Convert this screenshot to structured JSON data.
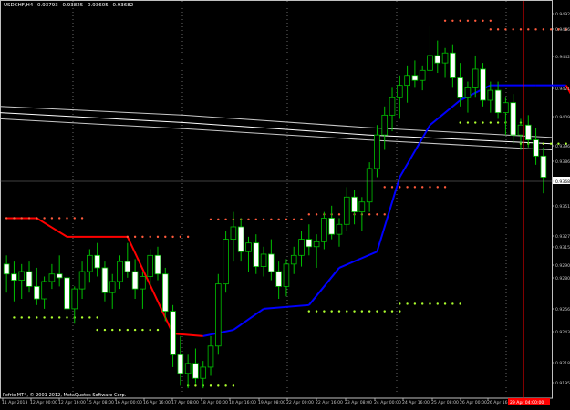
{
  "header": {
    "symbol_timeframe": "USDCHF,H4",
    "ohlc": [
      "0.93793",
      "0.93825",
      "0.93605",
      "0.93682"
    ]
  },
  "footer": {
    "copyright": "Pefrio MT4, © 2001-2012, MetaQuotes Software Corp."
  },
  "colors": {
    "background": "#000000",
    "axis": "#c0c0c0",
    "grid": "#808080",
    "bull": "#00c000",
    "bear_body": "#ffffff",
    "trend_up": "#0000ff",
    "trend_down": "#ff0000",
    "dot_upper": "#ff5a3c",
    "dot_lower": "#adff2f",
    "ma": "#c8c8c8",
    "current_price_box": "#ffffff",
    "vline": "#ff0000"
  },
  "price_axis": {
    "labels": [
      "0.94920",
      "0.94665",
      "0.94420",
      "0.94210",
      "0.94095",
      "0.93960",
      "0.93865",
      "0.93682",
      "0.93510",
      "0.93270",
      "0.93150",
      "0.92905",
      "0.92800",
      "0.92565",
      "0.92435",
      "0.92185",
      "0.91950"
    ],
    "current_price": "0.93682"
  },
  "time_axis": {
    "labels": [
      "11 Apr 2013",
      "12 Apr 00:00",
      "12 Apr 16:00",
      "15 Apr 08:00",
      "16 Apr 00:00",
      "16 Apr 16:00",
      "17 Apr 08:00",
      "18 Apr 00:00",
      "18 Apr 16:00",
      "19 Apr 08:00",
      "22 Apr 00:00",
      "22 Apr 16:00",
      "23 Apr 08:00",
      "24 Apr 00:00",
      "24 Apr 16:00",
      "25 Apr 08:00",
      "26 Apr 00:00",
      "26 Apr 16:00"
    ],
    "highlight_label": "29 Apr 04:00:00"
  },
  "chart_data": {
    "type": "candlestick",
    "price_range": [
      0.919,
      0.951
    ],
    "candles": [
      [
        0.9298,
        0.9305,
        0.9275,
        0.929
      ],
      [
        0.929,
        0.93,
        0.9268,
        0.9285
      ],
      [
        0.9285,
        0.9298,
        0.927,
        0.9292
      ],
      [
        0.9292,
        0.93,
        0.9275,
        0.928
      ],
      [
        0.928,
        0.9295,
        0.9265,
        0.927
      ],
      [
        0.927,
        0.9288,
        0.9262,
        0.9284
      ],
      [
        0.9284,
        0.9298,
        0.9278,
        0.929
      ],
      [
        0.929,
        0.9305,
        0.928,
        0.9287
      ],
      [
        0.9287,
        0.9292,
        0.9255,
        0.9262
      ],
      [
        0.9262,
        0.928,
        0.925,
        0.9278
      ],
      [
        0.9278,
        0.93,
        0.927,
        0.9292
      ],
      [
        0.9292,
        0.931,
        0.9283,
        0.9305
      ],
      [
        0.9305,
        0.9315,
        0.9288,
        0.9295
      ],
      [
        0.9295,
        0.93,
        0.9268,
        0.9275
      ],
      [
        0.9275,
        0.929,
        0.9262,
        0.9284
      ],
      [
        0.9284,
        0.9305,
        0.9278,
        0.93
      ],
      [
        0.93,
        0.9315,
        0.9287,
        0.9292
      ],
      [
        0.9292,
        0.9302,
        0.927,
        0.9278
      ],
      [
        0.9278,
        0.9292,
        0.9262,
        0.9288
      ],
      [
        0.9288,
        0.931,
        0.928,
        0.9305
      ],
      [
        0.9305,
        0.9312,
        0.9285,
        0.929
      ],
      [
        0.929,
        0.9295,
        0.9252,
        0.926
      ],
      [
        0.926,
        0.9265,
        0.9215,
        0.9225
      ],
      [
        0.9225,
        0.924,
        0.92,
        0.921
      ],
      [
        0.921,
        0.9225,
        0.9198,
        0.9218
      ],
      [
        0.9218,
        0.923,
        0.9202,
        0.9206
      ],
      [
        0.9206,
        0.922,
        0.9198,
        0.9215
      ],
      [
        0.9215,
        0.924,
        0.9208,
        0.9232
      ],
      [
        0.9232,
        0.929,
        0.9225,
        0.9282
      ],
      [
        0.9282,
        0.9325,
        0.9275,
        0.9318
      ],
      [
        0.9318,
        0.934,
        0.93,
        0.9328
      ],
      [
        0.9328,
        0.9335,
        0.93,
        0.9308
      ],
      [
        0.9308,
        0.932,
        0.9292,
        0.9315
      ],
      [
        0.9315,
        0.9322,
        0.929,
        0.9296
      ],
      [
        0.9296,
        0.9312,
        0.9288,
        0.9306
      ],
      [
        0.9306,
        0.9318,
        0.9285,
        0.9292
      ],
      [
        0.9292,
        0.93,
        0.927,
        0.928
      ],
      [
        0.928,
        0.9302,
        0.9272,
        0.9298
      ],
      [
        0.9298,
        0.9312,
        0.929,
        0.9305
      ],
      [
        0.9305,
        0.9325,
        0.9296,
        0.9318
      ],
      [
        0.9318,
        0.933,
        0.9305,
        0.9312
      ],
      [
        0.9312,
        0.9322,
        0.9295,
        0.9316
      ],
      [
        0.9316,
        0.934,
        0.931,
        0.9335
      ],
      [
        0.9335,
        0.9345,
        0.9318,
        0.9322
      ],
      [
        0.9322,
        0.9335,
        0.9312,
        0.933
      ],
      [
        0.933,
        0.936,
        0.9325,
        0.9352
      ],
      [
        0.9352,
        0.9358,
        0.933,
        0.934
      ],
      [
        0.934,
        0.9352,
        0.9325,
        0.9348
      ],
      [
        0.9348,
        0.938,
        0.934,
        0.9375
      ],
      [
        0.9375,
        0.941,
        0.9368,
        0.9402
      ],
      [
        0.9402,
        0.9425,
        0.939,
        0.9418
      ],
      [
        0.9418,
        0.944,
        0.9405,
        0.9432
      ],
      [
        0.9432,
        0.945,
        0.9415,
        0.9442
      ],
      [
        0.9442,
        0.9458,
        0.9428,
        0.945
      ],
      [
        0.945,
        0.9462,
        0.944,
        0.9446
      ],
      [
        0.9446,
        0.9458,
        0.9438,
        0.9454
      ],
      [
        0.9454,
        0.949,
        0.9445,
        0.9466
      ],
      [
        0.9466,
        0.9478,
        0.9452,
        0.946
      ],
      [
        0.946,
        0.9472,
        0.9448,
        0.9468
      ],
      [
        0.9468,
        0.9475,
        0.944,
        0.9448
      ],
      [
        0.9448,
        0.946,
        0.9425,
        0.9432
      ],
      [
        0.9432,
        0.9445,
        0.942,
        0.944
      ],
      [
        0.944,
        0.9466,
        0.9432,
        0.9455
      ],
      [
        0.9455,
        0.946,
        0.9425,
        0.943
      ],
      [
        0.943,
        0.9445,
        0.942,
        0.9438
      ],
      [
        0.9438,
        0.9445,
        0.9415,
        0.942
      ],
      [
        0.942,
        0.9432,
        0.9402,
        0.9428
      ],
      [
        0.9428,
        0.9435,
        0.9395,
        0.9402
      ],
      [
        0.9402,
        0.9415,
        0.939,
        0.941
      ],
      [
        0.941,
        0.9418,
        0.9392,
        0.9398
      ],
      [
        0.9398,
        0.9408,
        0.9378,
        0.9385
      ],
      [
        0.9385,
        0.9392,
        0.9355,
        0.9368
      ]
    ],
    "trend_line": [
      [
        0,
        0.9335,
        "down"
      ],
      [
        4,
        0.9335,
        "down"
      ],
      [
        8,
        0.932,
        "down"
      ],
      [
        16,
        0.932,
        "down"
      ],
      [
        22,
        0.9242,
        "down"
      ],
      [
        26,
        0.924,
        "down"
      ],
      [
        26,
        0.924,
        "up"
      ],
      [
        30,
        0.9245,
        "up"
      ],
      [
        34,
        0.9262,
        "up"
      ],
      [
        40,
        0.9265,
        "up"
      ],
      [
        44,
        0.9295,
        "up"
      ],
      [
        49,
        0.9308,
        "up"
      ],
      [
        52,
        0.9368,
        "up"
      ],
      [
        56,
        0.941,
        "up"
      ],
      [
        60,
        0.943,
        "up"
      ],
      [
        64,
        0.9442,
        "up"
      ],
      [
        70,
        0.9442,
        "up"
      ],
      [
        74,
        0.9442,
        "up"
      ],
      [
        76,
        0.942,
        "down"
      ],
      [
        78,
        0.9412,
        "down"
      ]
    ],
    "upper_dots": [
      {
        "from": 0,
        "to": 10,
        "price": 0.9335
      },
      {
        "from": 16,
        "to": 24,
        "price": 0.932
      },
      {
        "from": 27,
        "to": 39,
        "price": 0.9334
      },
      {
        "from": 40,
        "to": 50,
        "price": 0.9338
      },
      {
        "from": 50,
        "to": 58,
        "price": 0.936
      },
      {
        "from": 58,
        "to": 64,
        "price": 0.9494
      },
      {
        "from": 64,
        "to": 74,
        "price": 0.9487
      }
    ],
    "lower_dots": [
      {
        "from": 1,
        "to": 12,
        "price": 0.9255
      },
      {
        "from": 12,
        "to": 20,
        "price": 0.9245
      },
      {
        "from": 24,
        "to": 30,
        "price": 0.92
      },
      {
        "from": 40,
        "to": 52,
        "price": 0.926
      },
      {
        "from": 52,
        "to": 60,
        "price": 0.9266
      },
      {
        "from": 60,
        "to": 68,
        "price": 0.9412
      },
      {
        "from": 68,
        "to": 76,
        "price": 0.9395
      },
      {
        "from": 76,
        "to": 79,
        "price": 0.9385
      }
    ],
    "ma_lines": [
      [
        0.9425,
        0.9418,
        0.9408,
        0.94
      ],
      [
        0.942,
        0.9412,
        0.9402,
        0.9395
      ],
      [
        0.9415,
        0.9407,
        0.9398,
        0.939
      ]
    ]
  }
}
